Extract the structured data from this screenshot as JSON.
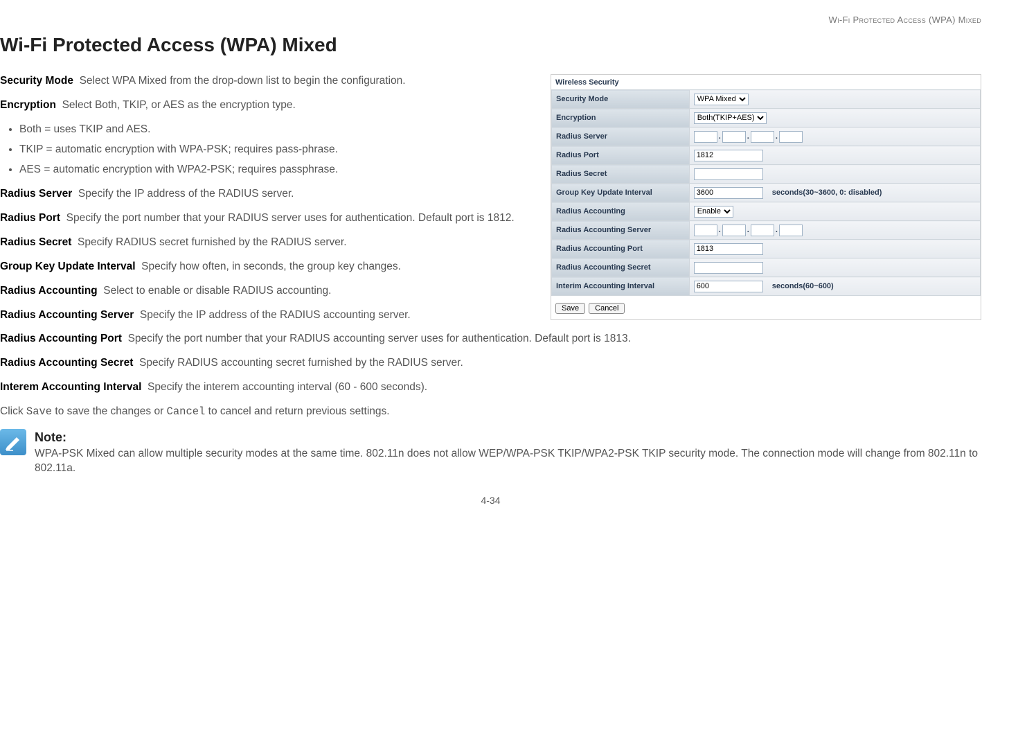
{
  "header_breadcrumb": "Wi-Fi Protected Access (WPA) Mixed",
  "page_title": "Wi-Fi Protected Access (WPA) Mixed",
  "paras": {
    "security_mode": {
      "term": "Security Mode",
      "desc": "Select WPA Mixed from the drop-down list to begin the configuration."
    },
    "encryption": {
      "term": "Encryption",
      "desc": "Select Both, TKIP, or AES as the encryption type."
    },
    "radius_server": {
      "term": "Radius Server",
      "desc": "Specify the IP address of the RADIUS server."
    },
    "radius_port": {
      "term": "Radius Port",
      "desc": "Specify the port number that your RADIUS server uses for authentication. Default port is 1812."
    },
    "radius_secret": {
      "term": "Radius Secret",
      "desc": "Specify RADIUS secret furnished by the RADIUS server."
    },
    "gkui": {
      "term": "Group Key Update Interval",
      "desc": "Specify how often, in seconds, the group key changes."
    },
    "racct": {
      "term": "Radius Accounting",
      "desc": "Select to enable or disable RADIUS accounting."
    },
    "racct_server": {
      "term": "Radius Accounting Server",
      "desc": "Specify the IP address of the RADIUS accounting server."
    },
    "racct_port": {
      "term": "Radius Accounting Port",
      "desc": "Specify the port number that your RADIUS accounting server uses for authentication. Default port is 1813."
    },
    "racct_secret": {
      "term": "Radius Accounting Secret",
      "desc": "Specify RADIUS accounting secret furnished by the RADIUS server."
    },
    "interem": {
      "term": "Interem Accounting Interval",
      "desc": "Specify the interem accounting interval (60 - 600 seconds)."
    }
  },
  "enc_bullets": [
    "Both = uses TKIP and AES.",
    "TKIP = automatic encryption with WPA-PSK; requires pass-phrase.",
    "AES = automatic encryption with WPA2-PSK; requires passphrase."
  ],
  "save_line": {
    "pre": "Click ",
    "save": "Save",
    "mid": " to save the changes or ",
    "cancel": "Cancel",
    "post": " to cancel and return previous settings."
  },
  "note": {
    "title": "Note:",
    "body": "WPA-PSK Mixed can allow multiple security modes at the same time. 802.11n does not allow WEP/WPA-PSK TKIP/WPA2-PSK TKIP security mode. The connection mode will change from 802.11n to 802.11a."
  },
  "page_number": "4-34",
  "figure": {
    "section_title": "Wireless Security",
    "rows": {
      "security_mode": {
        "label": "Security Mode",
        "value": "WPA Mixed"
      },
      "encryption": {
        "label": "Encryption",
        "value": "Both(TKIP+AES)"
      },
      "radius_server": {
        "label": "Radius Server"
      },
      "radius_port": {
        "label": "Radius Port",
        "value": "1812"
      },
      "radius_secret": {
        "label": "Radius Secret",
        "value": ""
      },
      "gkui": {
        "label": "Group Key Update Interval",
        "value": "3600",
        "hint": "seconds(30~3600, 0: disabled)"
      },
      "racct": {
        "label": "Radius Accounting",
        "value": "Enable"
      },
      "racct_server": {
        "label": "Radius Accounting Server"
      },
      "racct_port": {
        "label": "Radius Accounting Port",
        "value": "1813"
      },
      "racct_secret": {
        "label": "Radius Accounting Secret",
        "value": ""
      },
      "iai": {
        "label": "Interim Accounting Interval",
        "value": "600",
        "hint": "seconds(60~600)"
      }
    },
    "buttons": {
      "save": "Save",
      "cancel": "Cancel"
    }
  }
}
